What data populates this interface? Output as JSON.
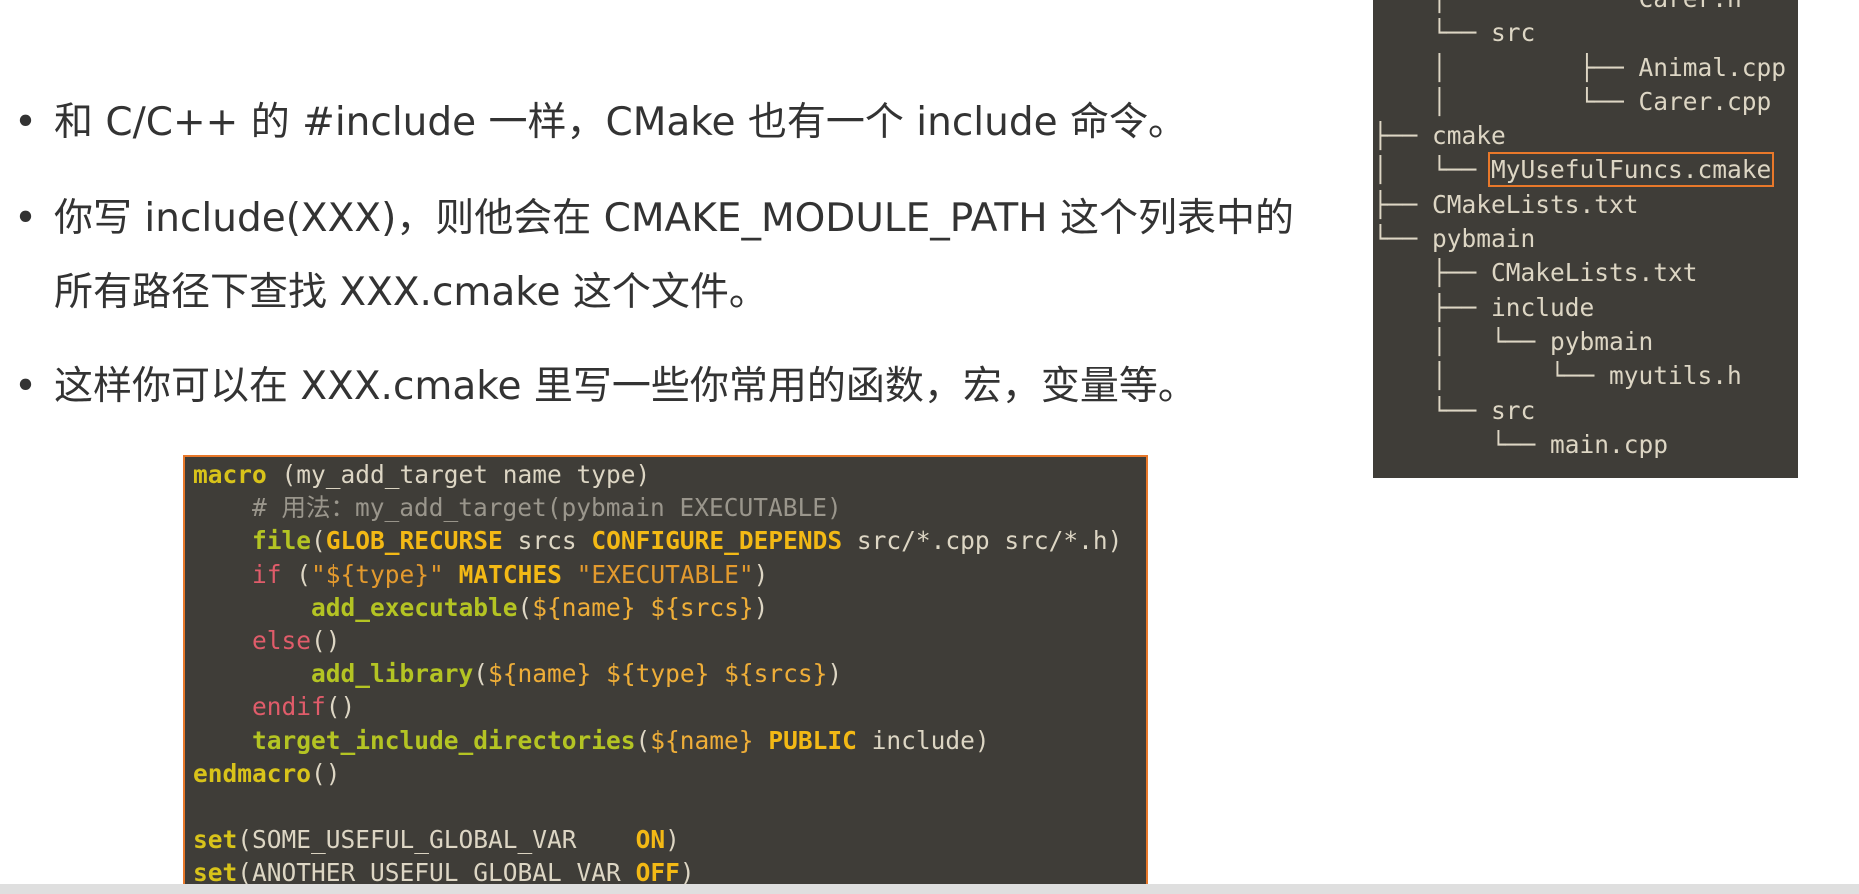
{
  "slide": {
    "bullets": [
      {
        "marker": "•",
        "text": "和 C/C++ 的 #include 一样，CMake 也有一个 include 命令。"
      },
      {
        "marker": "•",
        "text": "你写 include(XXX)，则他会在 CMAKE_MODULE_PATH 这个列表中的所有路径下查找 XXX.cmake 这个文件。"
      },
      {
        "marker": "•",
        "text": "这样你可以在 XXX.cmake 里写一些你常用的函数，宏，变量等。"
      }
    ]
  },
  "code": {
    "tokens": {
      "macro": "macro",
      "macro_sig": " (my_add_target name type)",
      "comment": "# 用法：my_add_target(pybmain EXECUTABLE)",
      "file": "file",
      "glob_recurse": "GLOB_RECURSE",
      "srcs": " srcs ",
      "configure_depends": "CONFIGURE_DEPENDS",
      "file_args": " src/*.cpp src/*.h)",
      "if": "if",
      "if_open": " (",
      "type_str": "\"${type}\"",
      "matches": "MATCHES",
      "exec_str": "\"EXECUTABLE\"",
      "add_executable": "add_executable",
      "name_var": "${name}",
      "srcs_var": "${srcs}",
      "else": "else",
      "add_library": "add_library",
      "type_var": "${type}",
      "endif": "endif",
      "target_include_directories": "target_include_directories",
      "public": "PUBLIC",
      "include_arg": " include)",
      "endmacro": "endmacro",
      "set": "set",
      "var1": "SOME_USEFUL_GLOBAL_VAR",
      "on": "ON",
      "var2": "ANOTHER_USEFUL_GLOBAL_VAR",
      "off": "OFF"
    }
  },
  "tree": {
    "lines": [
      {
        "prefix": "    │         └── ",
        "name": "Carer.h"
      },
      {
        "prefix": "    └── ",
        "name": "src"
      },
      {
        "prefix": "    │         ├── ",
        "name": "Animal.cpp"
      },
      {
        "prefix": "    │         └── ",
        "name": "Carer.cpp"
      },
      {
        "prefix": "├── ",
        "name": "cmake"
      },
      {
        "prefix": "│   └── ",
        "name": "MyUsefulFuncs.cmake",
        "highlight": true
      },
      {
        "prefix": "├── ",
        "name": "CMakeLists.txt"
      },
      {
        "prefix": "└── ",
        "name": "pybmain"
      },
      {
        "prefix": "    ├── ",
        "name": "CMakeLists.txt"
      },
      {
        "prefix": "    ├── ",
        "name": "include"
      },
      {
        "prefix": "    │   └── ",
        "name": "pybmain"
      },
      {
        "prefix": "    │       └── ",
        "name": "myutils.h"
      },
      {
        "prefix": "    └── ",
        "name": "src"
      },
      {
        "prefix": "        └── ",
        "name": "main.cpp"
      }
    ]
  },
  "colors": {
    "code_background": "#3f3d38",
    "highlight_border": "#e8782a",
    "keyword": "#d8c31a",
    "function": "#b4c423",
    "control_flow": "#e05c6a",
    "string": "#e39a2e"
  }
}
